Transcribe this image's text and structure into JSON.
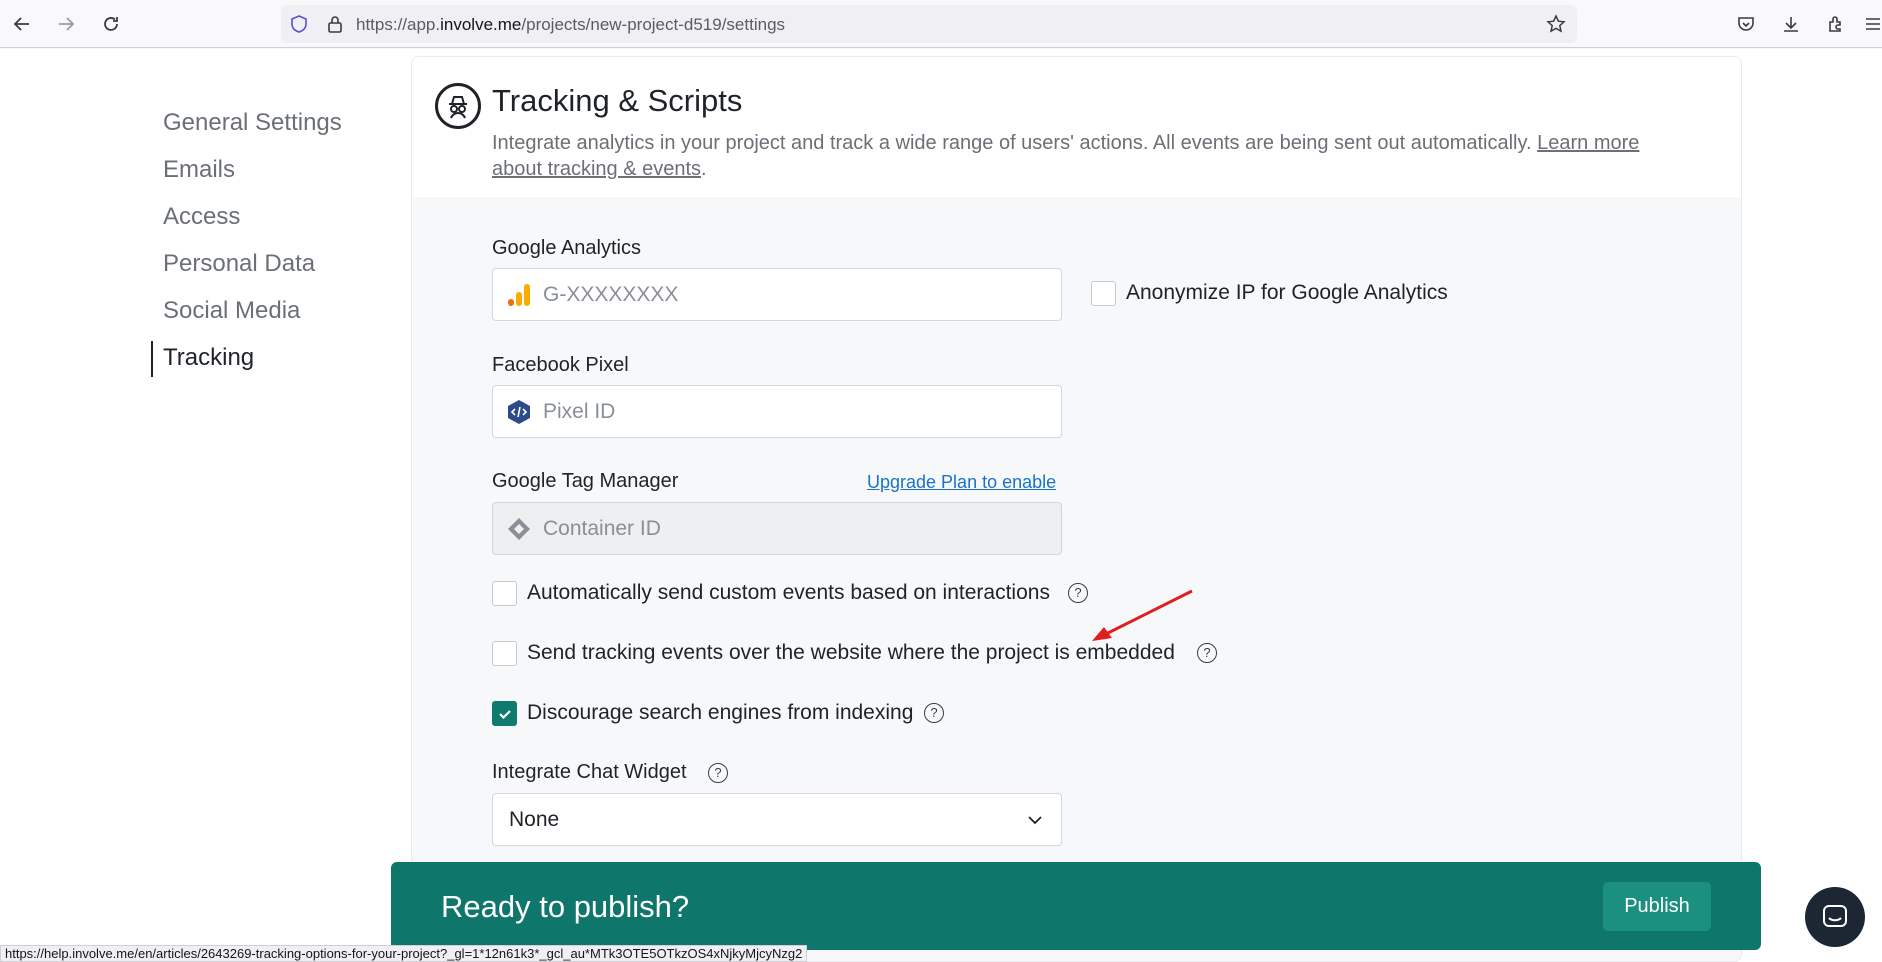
{
  "browser": {
    "url_prefix": "https://app.",
    "url_domain": "involve.me",
    "url_path": "/projects/new-project-d519/settings"
  },
  "sidebar": {
    "items": [
      {
        "label": "General Settings"
      },
      {
        "label": "Emails"
      },
      {
        "label": "Access"
      },
      {
        "label": "Personal Data"
      },
      {
        "label": "Social Media"
      },
      {
        "label": "Tracking"
      }
    ],
    "active": "Tracking"
  },
  "header": {
    "title": "Tracking & Scripts",
    "description": "Integrate analytics in your project and track a wide range of users' actions. All events are being sent out automatically.",
    "link_text": "Learn more about tracking & events",
    "period": "."
  },
  "google_analytics": {
    "label": "Google Analytics",
    "placeholder": "G-XXXXXXXX",
    "anonymize_label": "Anonymize IP for Google Analytics"
  },
  "facebook_pixel": {
    "label": "Facebook Pixel",
    "placeholder": "Pixel ID"
  },
  "google_tag_manager": {
    "label": "Google Tag Manager",
    "upgrade_link": "Upgrade Plan to enable",
    "placeholder": "Container ID"
  },
  "options": {
    "custom_events": "Automatically send custom events based on interactions",
    "tracking_events": "Send tracking events over the website where the project is embedded",
    "discourage_indexing": "Discourage search engines from indexing"
  },
  "chat_widget": {
    "label": "Integrate Chat Widget",
    "selected": "None"
  },
  "help_glyph": "?",
  "publish_bar": {
    "text": "Ready to publish?",
    "button": "Publish"
  },
  "status_bar": {
    "url": "https://help.involve.me/en/articles/2643269-tracking-options-for-your-project?_gl=1*12n61k3*_gcl_au*MTk3OTE5OTkzOS4xNjkyMjcyNzg2"
  },
  "colors": {
    "accent": "#0f766b",
    "checkbox_checked": "#0f7a6e",
    "link": "#1a73c8",
    "annotation_arrow": "#e11d1d"
  }
}
